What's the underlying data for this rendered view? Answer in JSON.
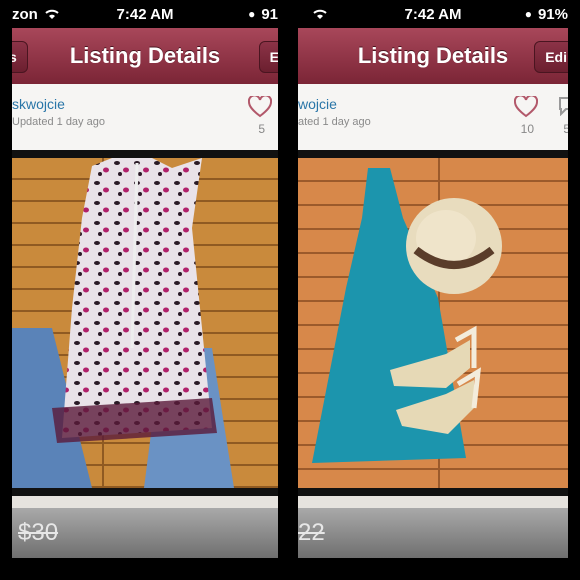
{
  "left": {
    "status": {
      "carrier": "zon",
      "time": "7:42 AM",
      "battery": "91"
    },
    "nav": {
      "title": "Listing Details",
      "left_button": "s",
      "right_button": "E"
    },
    "listing": {
      "username": "skwojcie",
      "updated": "Updated 1 day ago",
      "likes": "5",
      "price": "$30"
    }
  },
  "right": {
    "status": {
      "time": "7:42 AM",
      "battery": "91%"
    },
    "nav": {
      "title": "Listing Details",
      "right_button": "Edi"
    },
    "listing": {
      "username": "wojcie",
      "updated": "ated 1 day ago",
      "likes": "10",
      "comments": "5",
      "price": "22"
    }
  },
  "colors": {
    "nav": "#8c3347",
    "link": "#2a76a8",
    "like": "#b2586a"
  }
}
